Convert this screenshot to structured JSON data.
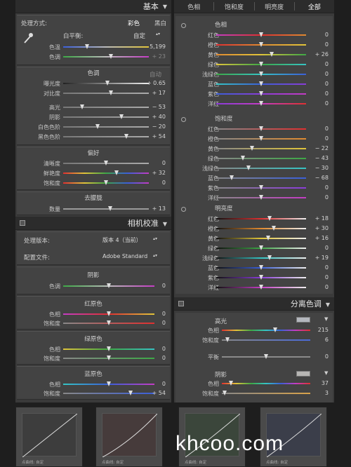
{
  "basic": {
    "header": "基本",
    "treatment_label": "处理方式:",
    "color": "彩色",
    "bw": "黑白",
    "wb_label": "白平衡:",
    "wb_value": "自定",
    "temp_label": "色温",
    "temp_value": "5,199",
    "tint_label": "色调",
    "tint_value": "+ 23",
    "tone_title": "色调",
    "auto": "自动",
    "tone": [
      {
        "label": "曝光度",
        "value": "+ 0.65",
        "pos": 0.52
      },
      {
        "label": "对比度",
        "value": "+ 17",
        "pos": 0.56
      }
    ],
    "tone2": [
      {
        "label": "高光",
        "value": "− 53",
        "pos": 0.22
      },
      {
        "label": "阴影",
        "value": "+ 40",
        "pos": 0.68
      },
      {
        "label": "白色色阶",
        "value": "− 20",
        "pos": 0.4
      },
      {
        "label": "黑色色阶",
        "value": "+ 54",
        "pos": 0.74
      }
    ],
    "presence_title": "偏好",
    "presence": [
      {
        "label": "清晰度",
        "value": "0",
        "pos": 0.5
      },
      {
        "label": "鲜艳度",
        "value": "+ 32",
        "pos": 0.62
      },
      {
        "label": "饱和度",
        "value": "0",
        "pos": 0.5
      }
    ],
    "dehaze_title": "去朦胧",
    "dehaze_label": "数量",
    "dehaze_value": "+ 13",
    "temp_pos": 0.28,
    "tint_pos": 0.56,
    "dehaze_pos": 0.55
  },
  "calib": {
    "header": "相机校准",
    "process_label": "处理版本:",
    "process_value": "版本 4（当前）",
    "profile_label": "配置文件:",
    "profile_value": "Adobe Standard",
    "shadow_title": "阴影",
    "shadow_tint_label": "色调",
    "shadow_tint_value": "0",
    "red_title": "红原色",
    "green_title": "绿原色",
    "blue_title": "蓝原色",
    "hue_label": "色相",
    "sat_label": "饱和度",
    "red_hue": "0",
    "red_sat": "0",
    "green_hue": "0",
    "green_sat": "0",
    "blue_hue": "0",
    "blue_sat": "+ 54",
    "blue_sat_pos": 0.74
  },
  "hsl": {
    "tabs": [
      "色相",
      "饱和度",
      "明亮度",
      "全部"
    ],
    "hue_title": "色相",
    "sat_title": "饱和度",
    "lum_title": "明亮度",
    "colors": [
      "红色",
      "橙色",
      "黄色",
      "绿色",
      "浅绿色",
      "蓝色",
      "紫色",
      "洋红"
    ],
    "hue": [
      {
        "v": "0",
        "p": 0.5
      },
      {
        "v": "0",
        "p": 0.5
      },
      {
        "v": "+ 26",
        "p": 0.62
      },
      {
        "v": "0",
        "p": 0.5
      },
      {
        "v": "0",
        "p": 0.5
      },
      {
        "v": "0",
        "p": 0.5
      },
      {
        "v": "0",
        "p": 0.5
      },
      {
        "v": "0",
        "p": 0.5
      }
    ],
    "sat": [
      {
        "v": "0",
        "p": 0.5
      },
      {
        "v": "0",
        "p": 0.5
      },
      {
        "v": "− 22",
        "p": 0.4
      },
      {
        "v": "− 43",
        "p": 0.3
      },
      {
        "v": "− 30",
        "p": 0.36
      },
      {
        "v": "− 68",
        "p": 0.17
      },
      {
        "v": "0",
        "p": 0.5
      },
      {
        "v": "0",
        "p": 0.5
      }
    ],
    "lum": [
      {
        "v": "+ 18",
        "p": 0.59
      },
      {
        "v": "+ 30",
        "p": 0.64
      },
      {
        "v": "+ 16",
        "p": 0.58
      },
      {
        "v": "0",
        "p": 0.5
      },
      {
        "v": "+ 19",
        "p": 0.59
      },
      {
        "v": "0",
        "p": 0.5
      },
      {
        "v": "0",
        "p": 0.5
      },
      {
        "v": "0",
        "p": 0.5
      }
    ]
  },
  "split": {
    "header": "分离色调",
    "highlight_title": "高光",
    "hue_label": "色相",
    "sat_label": "饱和度",
    "hl_hue": "215",
    "hl_sat": "6",
    "balance_label": "平衡",
    "balance": "0",
    "shadow_title": "阴影",
    "sh_hue": "37",
    "sh_sat": "3",
    "hl_hue_pos": 0.6,
    "hl_sat_pos": 0.06,
    "sh_hue_pos": 0.1,
    "sh_sat_pos": 0.03
  },
  "thumb_caption": "点曲线: 自定",
  "watermark": "khcoo.com",
  "accent": "#dedede"
}
